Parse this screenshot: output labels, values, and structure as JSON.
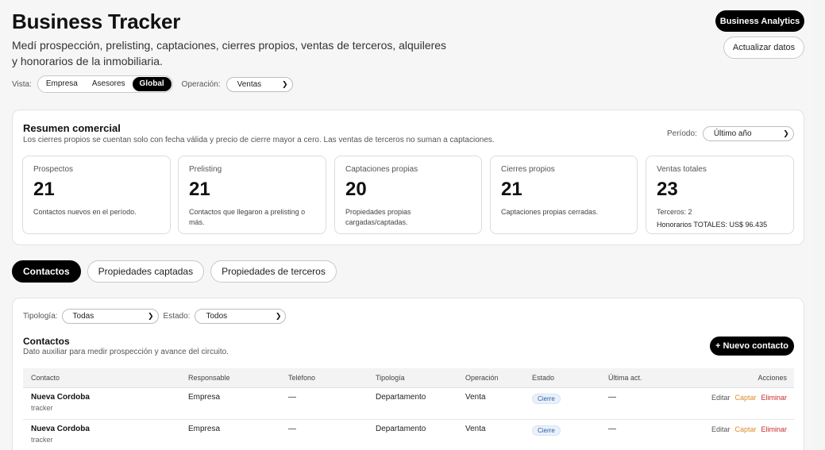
{
  "header": {
    "title": "Business Tracker",
    "subtitle_line1": "Medí prospección, prelisting, captaciones, cierres propios, ventas de terceros, alquileres",
    "subtitle_line2": "y honorarios de la inmobiliaria.",
    "analytics_label": "Business Analytics",
    "update_label": "Actualizar datos"
  },
  "filters": {
    "vista_label": "Vista:",
    "vista_options": [
      "Empresa",
      "Asesores",
      "Global"
    ],
    "vista_selected": "Global",
    "operacion_label": "Operación:",
    "operacion_value": "Ventas"
  },
  "summary": {
    "title": "Resumen comercial",
    "subtitle": "Los cierres propios se cuentan solo con fecha válida y precio de cierre mayor a cero. Las ventas de terceros no suman a captaciones.",
    "period_label": "Período:",
    "period_value": "Último año",
    "metrics": [
      {
        "label": "Prospectos",
        "value": "21",
        "desc": "Contactos nuevos en el período."
      },
      {
        "label": "Prelisting",
        "value": "21",
        "desc": "Contactos que llegaron a prelisting o más."
      },
      {
        "label": "Captaciones propias",
        "value": "20",
        "desc": "Propiedades propias cargadas/captadas."
      },
      {
        "label": "Cierres propios",
        "value": "21",
        "desc": "Captaciones propias cerradas."
      },
      {
        "label": "Ventas totales",
        "value": "23",
        "desc": "Terceros: 2",
        "desc2": "Honorarios TOTALES: US$ 96.435"
      }
    ]
  },
  "tabs": [
    "Contactos",
    "Propiedades captadas",
    "Propiedades de terceros"
  ],
  "contacts": {
    "tipologia_label": "Tipología:",
    "tipologia_value": "Todas",
    "estado_label": "Estado:",
    "estado_value": "Todos",
    "title": "Contactos",
    "subtitle": "Dato auxiliar para medir prospección y avance del circuito.",
    "new_label": "+ Nuevo contacto",
    "columns": [
      "Contacto",
      "Responsable",
      "Teléfono",
      "Tipología",
      "Operación",
      "Estado",
      "Última act.",
      "Acciones"
    ],
    "rows": [
      {
        "name": "Nueva Cordoba",
        "sub": "tracker",
        "responsable": "Empresa",
        "telefono": "—",
        "tipologia": "Departamento",
        "operacion": "Venta",
        "estado": "Cierre",
        "ultima": "—"
      },
      {
        "name": "Nueva Cordoba",
        "sub": "tracker",
        "responsable": "Empresa",
        "telefono": "—",
        "tipologia": "Departamento",
        "operacion": "Venta",
        "estado": "Cierre",
        "ultima": "—"
      }
    ],
    "actions": {
      "edit": "Editar",
      "capture": "Captar",
      "delete": "Eliminar"
    }
  }
}
